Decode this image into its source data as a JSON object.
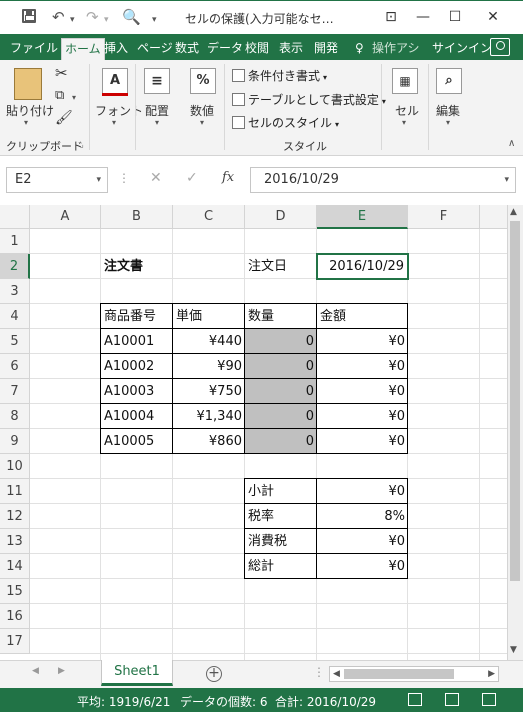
{
  "window": {
    "title": "セルの保護(入力可能なセ…",
    "undo_icon": "undo-icon",
    "redo_icon": "redo-icon"
  },
  "ribbon_tabs": [
    "ファイル",
    "ホーム",
    "挿入",
    "ページ",
    "数式",
    "データ",
    "校閲",
    "表示",
    "開発",
    "操作アシ",
    "サインイン"
  ],
  "ribbon": {
    "paste_label": "貼り付け",
    "clipboard_group": "クリップボード",
    "font_label": "フォント",
    "alignment_label": "配置",
    "number_label": "数値",
    "conditional_format": "条件付き書式",
    "format_as_table": "テーブルとして書式設定",
    "cell_styles": "セルのスタイル",
    "styles_group": "スタイル",
    "cells_label": "セル",
    "editing_label": "編集",
    "number_icon_text": "%",
    "font_icon_text": "A"
  },
  "formula_bar": {
    "name_box": "E2",
    "formula": "2016/10/29",
    "fx_label": "fx"
  },
  "grid": {
    "columns": [
      "A",
      "B",
      "C",
      "D",
      "E",
      "F"
    ],
    "rows": [
      "1",
      "2",
      "3",
      "4",
      "5",
      "6",
      "7",
      "8",
      "9",
      "10",
      "11",
      "12",
      "13",
      "14",
      "15",
      "16",
      "17"
    ],
    "cells": {
      "B2": "注文書",
      "D2": "注文日",
      "E2": "2016/10/29",
      "B4": "商品番号",
      "C4": "単価",
      "D4": "数量",
      "E4": "金額",
      "B5": "A10001",
      "C5": "¥440",
      "D5": "0",
      "E5": "¥0",
      "B6": "A10002",
      "C6": "¥90",
      "D6": "0",
      "E6": "¥0",
      "B7": "A10003",
      "C7": "¥750",
      "D7": "0",
      "E7": "¥0",
      "B8": "A10004",
      "C8": "¥1,340",
      "D8": "0",
      "E8": "¥0",
      "B9": "A10005",
      "C9": "¥860",
      "D9": "0",
      "E9": "¥0",
      "D11": "小計",
      "E11": "¥0",
      "D12": "税率",
      "E12": "8%",
      "D13": "消費税",
      "E13": "¥0",
      "D14": "総計",
      "E14": "¥0"
    },
    "selected_cell": "E2",
    "input_fill_color": "#c0c0c0"
  },
  "sheets": [
    "Sheet1"
  ],
  "status_bar": {
    "average": "平均: 1919/6/21",
    "count": "データの個数: 6",
    "sum": "合計: 2016/10/29"
  },
  "colors": {
    "accent": "#217346"
  }
}
